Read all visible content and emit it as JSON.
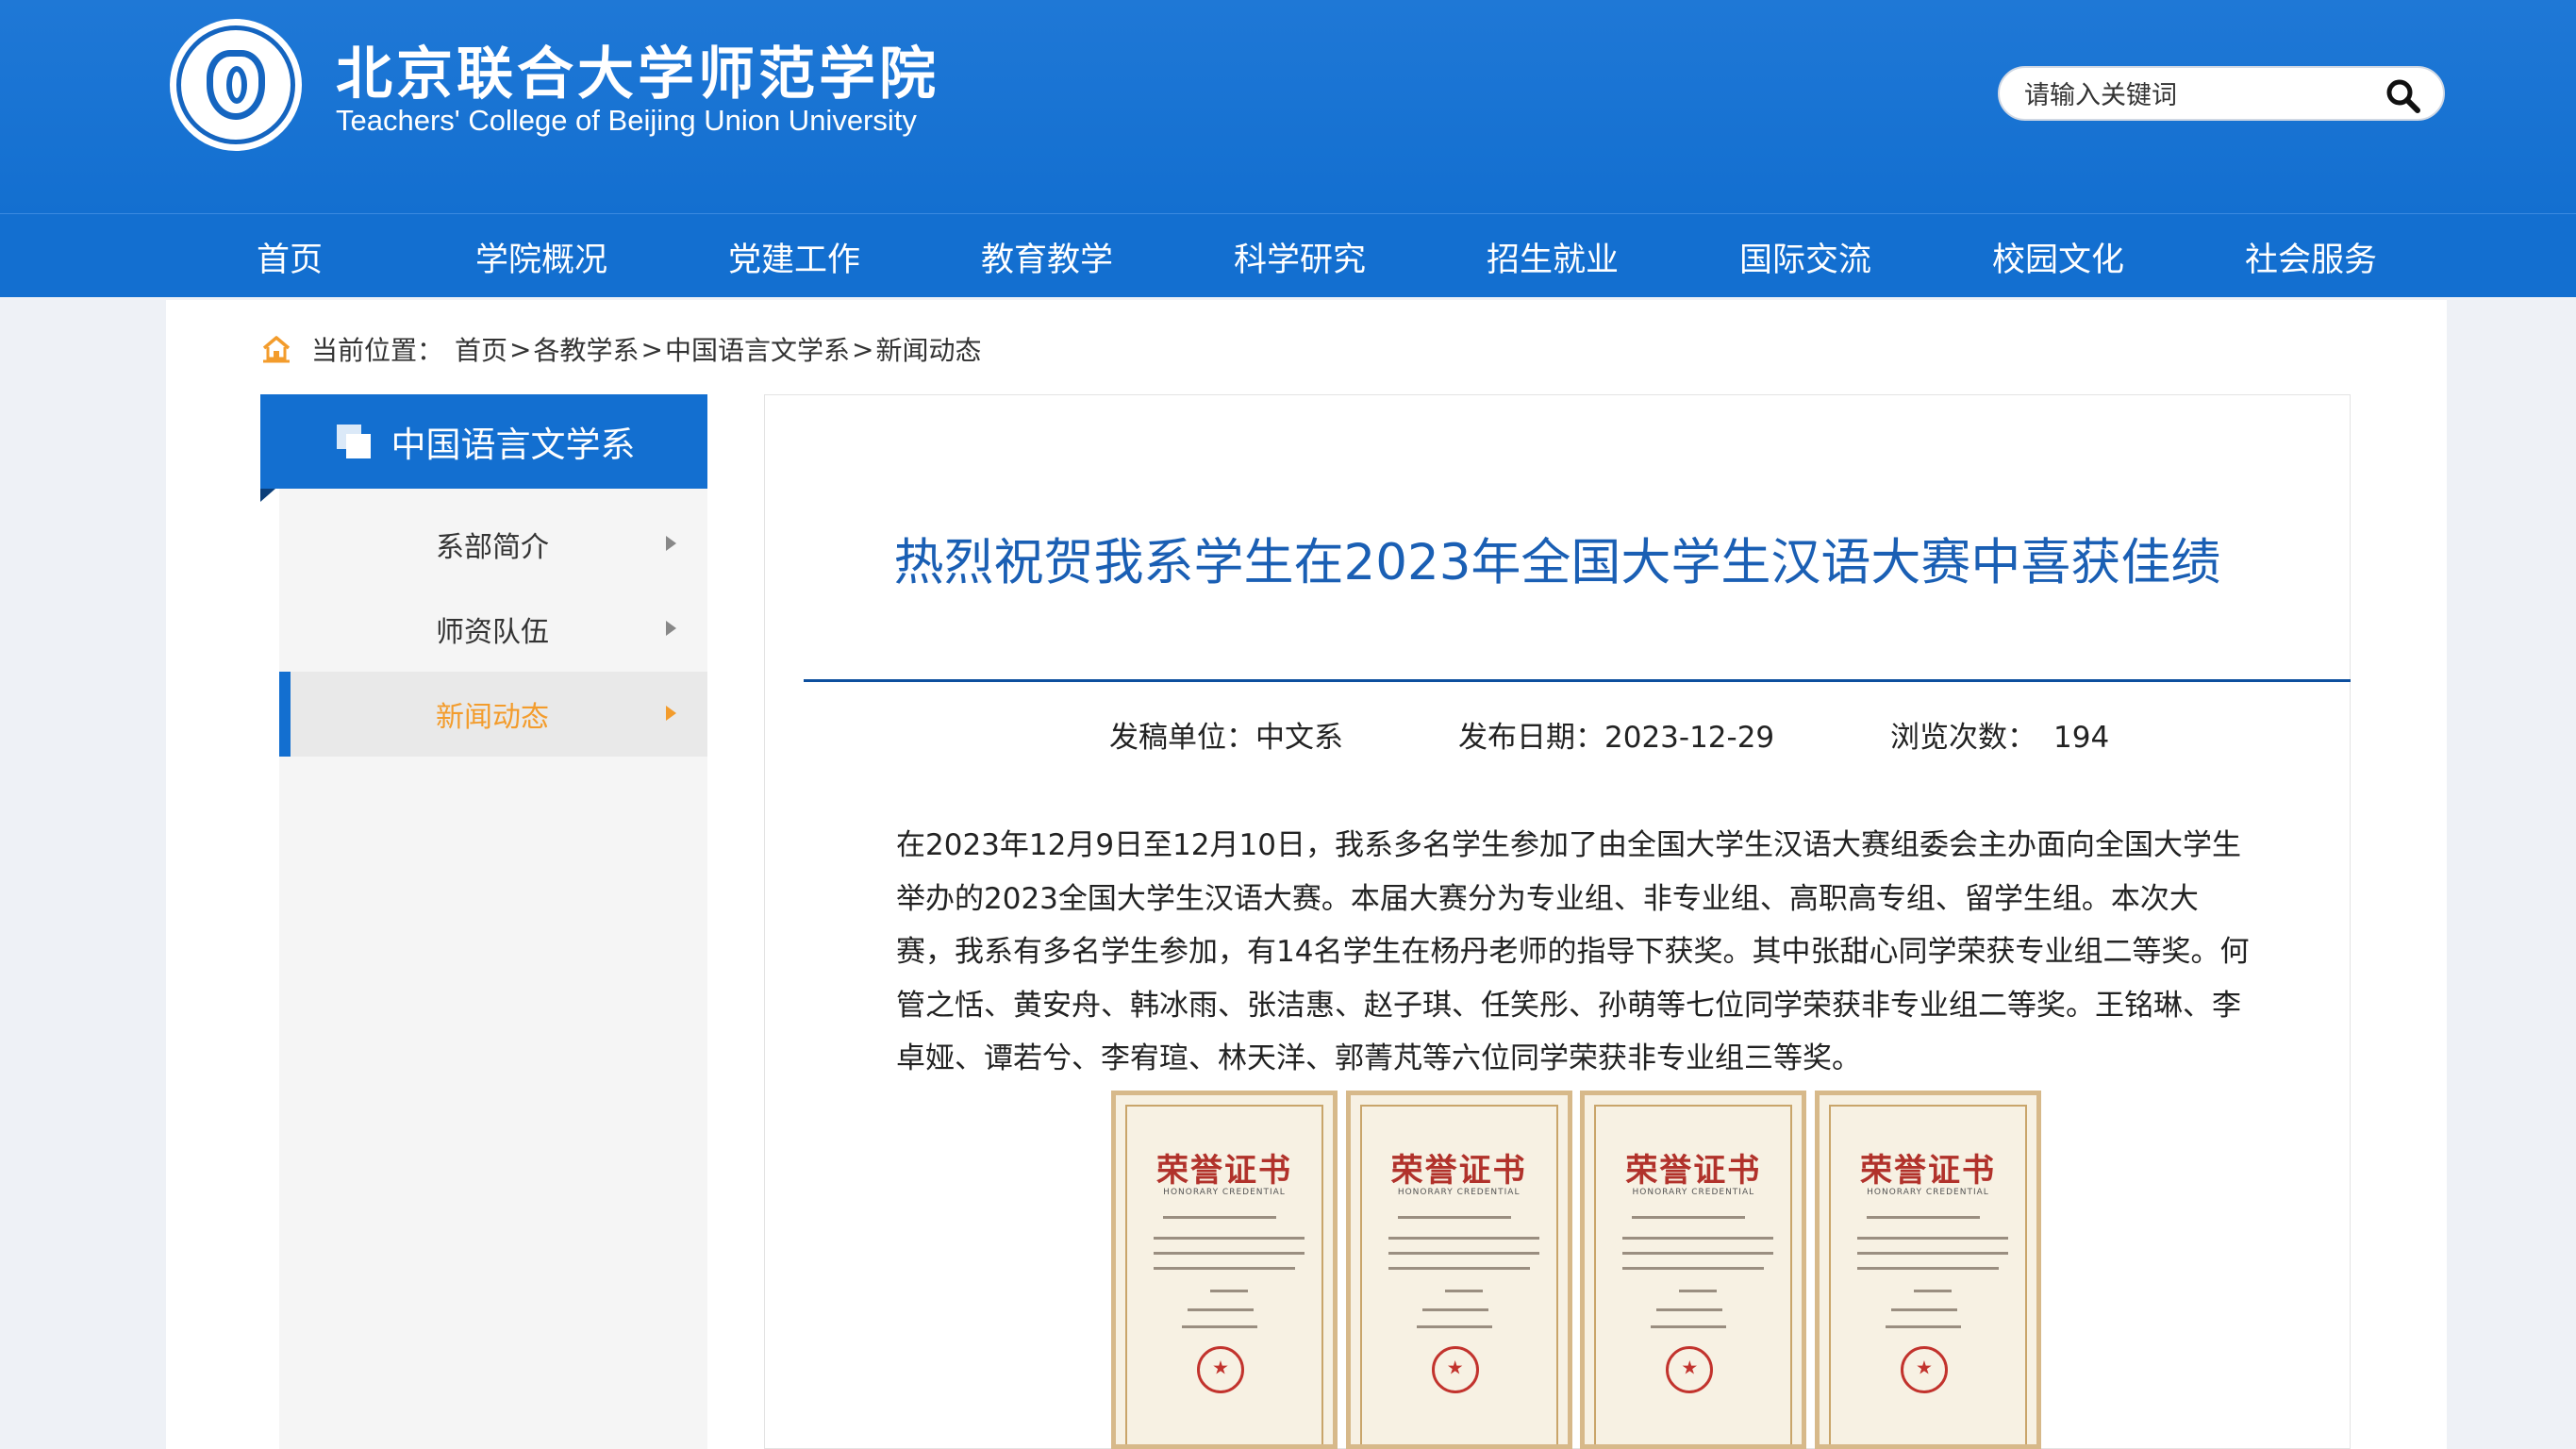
{
  "header": {
    "title": "北京联合大学师范学院",
    "subtitle": "Teachers' College of Beijing Union University",
    "search_placeholder": "请输入关键词"
  },
  "nav": [
    "首页",
    "学院概况",
    "党建工作",
    "教育教学",
    "科学研究",
    "招生就业",
    "国际交流",
    "校园文化",
    "社会服务"
  ],
  "breadcrumb": {
    "label": "当前位置：",
    "items": [
      "首页",
      "各教学系",
      "中国语言文学系",
      "新闻动态"
    ],
    "separator": ">"
  },
  "sidebar": {
    "title": "中国语言文学系",
    "items": [
      {
        "label": "系部简介",
        "active": false
      },
      {
        "label": "师资队伍",
        "active": false
      },
      {
        "label": "新闻动态",
        "active": true
      }
    ]
  },
  "article": {
    "title": "热烈祝贺我系学生在2023年全国大学生汉语大赛中喜获佳绩",
    "meta": {
      "unit_label": "发稿单位：",
      "unit": "中文系",
      "date_label": "发布日期：",
      "date": "2023-12-29",
      "views_label": "浏览次数：",
      "views": "194"
    },
    "body": "在2023年12月9日至12月10日，我系多名学生参加了由全国大学生汉语大赛组委会主办面向全国大学生举办的2023全国大学生汉语大赛。本届大赛分为专业组、非专业组、高职高专组、留学生组。本次大赛，我系有多名学生参加，有14名学生在杨丹老师的指导下获奖。其中张甜心同学荣获专业组二等奖。何管之恬、黄安舟、韩冰雨、张洁惠、赵子琪、任笑彤、孙萌等七位同学荣获非专业组二等奖。王铭琳、李卓娅、谭若兮、李宥瑄、林天洋、郭菁芃等六位同学荣获非专业组三等奖。",
    "certificates": [
      {
        "title": "荣誉证书",
        "subtitle": "HONORARY CREDENTIAL"
      },
      {
        "title": "荣誉证书",
        "subtitle": "HONORARY CREDENTIAL"
      },
      {
        "title": "荣誉证书",
        "subtitle": "HONORARY CREDENTIAL"
      },
      {
        "title": "荣誉证书",
        "subtitle": "HONORARY CREDENTIAL"
      }
    ]
  },
  "colors": {
    "brand_blue": "#136fd0",
    "title_blue": "#1a5fb4",
    "active_orange": "#f39c2c",
    "cert_red": "#b1322b"
  },
  "icons": [
    "school-logo-icon",
    "search-icon",
    "home-icon",
    "copy-icon",
    "chevron-right-icon",
    "seal-icon"
  ]
}
